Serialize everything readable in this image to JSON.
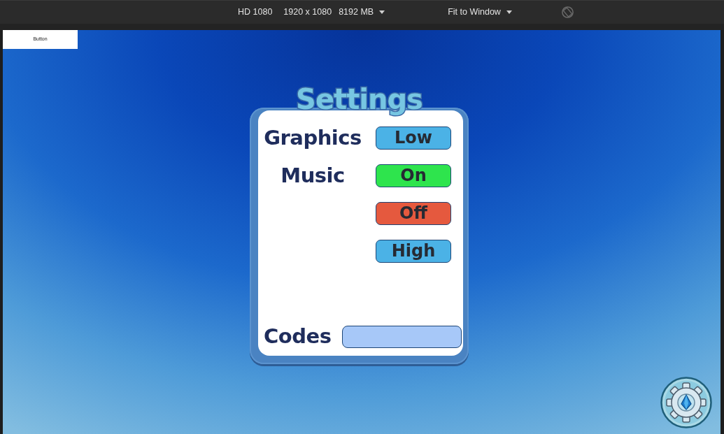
{
  "toolbar": {
    "items": [
      {
        "kind": "label",
        "text": "HD 1080"
      },
      {
        "kind": "label",
        "text": "1920 x 1080"
      },
      {
        "kind": "dropdown",
        "text": "8192 MB"
      },
      {
        "kind": "dropdown",
        "text": "Fit to Window"
      }
    ]
  },
  "game": {
    "corner_button": {
      "label": "Button"
    },
    "settings": {
      "title": "Settings",
      "rows": [
        {
          "label": "Graphics",
          "button": "Low",
          "color": "#4bb2e6"
        },
        {
          "label": "Music",
          "button": "On",
          "color": "#2ee44d"
        },
        {
          "button": "Off",
          "color": "#e5593e"
        },
        {
          "button": "High",
          "color": "#4bb2e6"
        }
      ],
      "codes": {
        "label": "Codes"
      }
    }
  }
}
